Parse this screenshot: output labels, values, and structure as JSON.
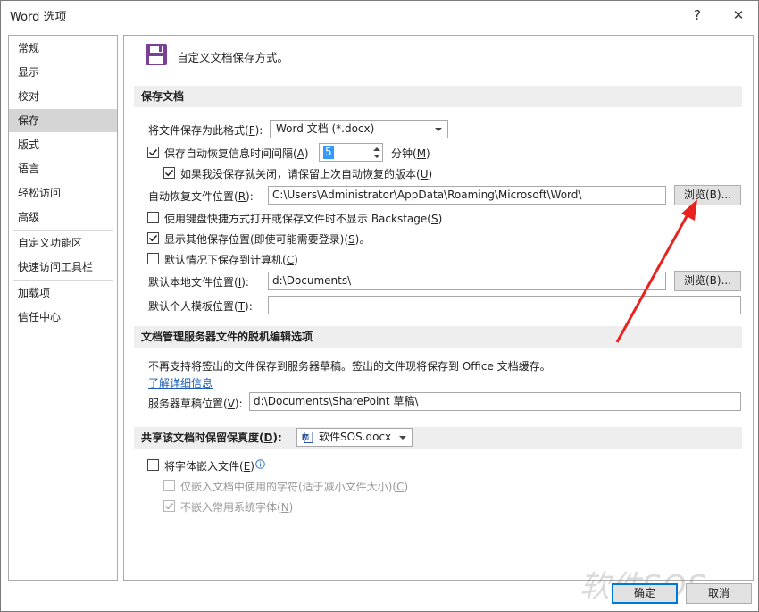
{
  "window": {
    "title": "Word 选项",
    "help_label": "?",
    "close_label": "✕"
  },
  "sidebar": {
    "items": [
      {
        "label": "常规"
      },
      {
        "label": "显示"
      },
      {
        "label": "校对"
      },
      {
        "label": "保存"
      },
      {
        "label": "版式"
      },
      {
        "label": "语言"
      },
      {
        "label": "轻松访问"
      },
      {
        "label": "高级"
      },
      {
        "label": "自定义功能区"
      },
      {
        "label": "快速访问工具栏"
      },
      {
        "label": "加载项"
      },
      {
        "label": "信任中心"
      }
    ],
    "selected": "保存"
  },
  "header": {
    "title": "自定义文档保存方式。",
    "icon": "floppy-disk-icon",
    "icon_color": "#7a3f97"
  },
  "save_docs": {
    "heading": "保存文档",
    "format_label_pre": "将文件保存为此格式(",
    "format_label_key": "F",
    "format_label_post": "):",
    "format_value": "Word 文档 (*.docx)",
    "autorecover_label_pre": "保存自动恢复信息时间间隔(",
    "autorecover_label_key": "A",
    "autorecover_label_post": ")",
    "autorecover_checked": true,
    "autorecover_minutes": "5",
    "minutes_label_pre": "分钟(",
    "minutes_label_key": "M",
    "minutes_label_post": ")",
    "keep_last_label_pre": "如果我没保存就关闭，请保留上次自动恢复的版本(",
    "keep_last_label_key": "U",
    "keep_last_label_post": ")",
    "keep_last_checked": true,
    "autorecover_location_label_pre": "自动恢复文件位置(",
    "autorecover_location_label_key": "R",
    "autorecover_location_label_post": "):",
    "autorecover_location_value": "C:\\Users\\Administrator\\AppData\\Roaming\\Microsoft\\Word\\",
    "browse1_label": "浏览(B)...",
    "no_backstage_label_pre": "使用键盘快捷方式打开或保存文件时不显示 Backstage(",
    "no_backstage_label_key": "S",
    "no_backstage_label_post": ")",
    "no_backstage_checked": false,
    "show_other_label_pre": "显示其他保存位置(即使可能需要登录)(",
    "show_other_label_key": "S",
    "show_other_label_post": ")。",
    "show_other_checked": true,
    "save_to_computer_label_pre": "默认情况下保存到计算机(",
    "save_to_computer_label_key": "C",
    "save_to_computer_label_post": ")",
    "save_to_computer_checked": false,
    "default_local_label_pre": "默认本地文件位置(",
    "default_local_label_key": "I",
    "default_local_label_post": "):",
    "default_local_value": "d:\\Documents\\",
    "browse2_label": "浏览(B)...",
    "default_template_label_pre": "默认个人模板位置(",
    "default_template_label_key": "T",
    "default_template_label_post": "):",
    "default_template_value": ""
  },
  "offline": {
    "heading": "文档管理服务器文件的脱机编辑选项",
    "info_text": "不再支持将签出的文件保存到服务器草稿。签出的文件现将保存到 Office 文档缓存。",
    "learn_more": "了解详细信息",
    "drafts_label_pre": "服务器草稿位置(",
    "drafts_label_key": "V",
    "drafts_label_post": "):",
    "drafts_value": "d:\\Documents\\SharePoint 草稿\\"
  },
  "fidelity": {
    "heading_pre": "共享该文档时保留保真度(",
    "heading_key": "D",
    "heading_post": "):",
    "doc_value": "软件SOS.docx",
    "embed_fonts_label_pre": "将字体嵌入文件(",
    "embed_fonts_label_key": "E",
    "embed_fonts_label_post": ")",
    "embed_fonts_checked": false,
    "only_used_label_pre": "仅嵌入文档中使用的字符(适于减小文件大小)(",
    "only_used_label_key": "C",
    "only_used_label_post": ")",
    "only_used_checked": false,
    "no_common_label_pre": "不嵌入常用系统字体(",
    "no_common_label_key": "N",
    "no_common_label_post": ")",
    "no_common_checked": true
  },
  "footer": {
    "ok_label": "确定",
    "cancel_label": "取消"
  },
  "watermark_text": "软件SOS",
  "annotation_color": "#e8231f"
}
